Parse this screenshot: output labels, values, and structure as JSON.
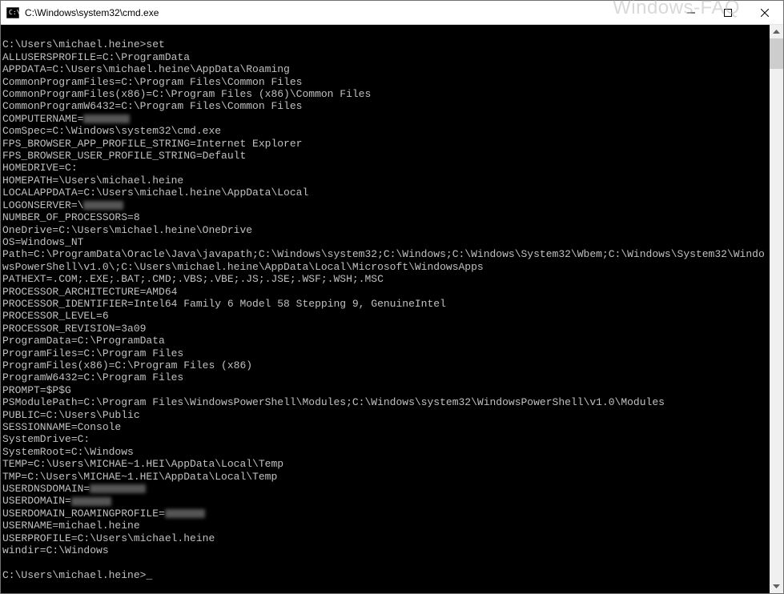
{
  "watermark": "Windows-FAQ",
  "window": {
    "title": "C:\\Windows\\system32\\cmd.exe"
  },
  "console": {
    "prompt1": "C:\\Users\\michael.heine>",
    "command1": "set",
    "prompt2": "C:\\Users\\michael.heine>",
    "envLines": [
      {
        "k": "ALLUSERSPROFILE",
        "v": "C:\\ProgramData"
      },
      {
        "k": "APPDATA",
        "v": "C:\\Users\\michael.heine\\AppData\\Roaming"
      },
      {
        "k": "CommonProgramFiles",
        "v": "C:\\Program Files\\Common Files"
      },
      {
        "k": "CommonProgramFiles(x86)",
        "v": "C:\\Program Files (x86)\\Common Files"
      },
      {
        "k": "CommonProgramW6432",
        "v": "C:\\Program Files\\Common Files"
      },
      {
        "k": "COMPUTERNAME",
        "v": "",
        "redacted": 58
      },
      {
        "k": "ComSpec",
        "v": "C:\\Windows\\system32\\cmd.exe"
      },
      {
        "k": "FPS_BROWSER_APP_PROFILE_STRING",
        "v": "Internet Explorer"
      },
      {
        "k": "FPS_BROWSER_USER_PROFILE_STRING",
        "v": "Default"
      },
      {
        "k": "HOMEDRIVE",
        "v": "C:"
      },
      {
        "k": "HOMEPATH",
        "v": "\\Users\\michael.heine"
      },
      {
        "k": "LOCALAPPDATA",
        "v": "C:\\Users\\michael.heine\\AppData\\Local"
      },
      {
        "k": "LOGONSERVER",
        "v": "\\",
        "redacted": 50
      },
      {
        "k": "NUMBER_OF_PROCESSORS",
        "v": "8"
      },
      {
        "k": "OneDrive",
        "v": "C:\\Users\\michael.heine\\OneDrive"
      },
      {
        "k": "OS",
        "v": "Windows_NT"
      },
      {
        "k": "Path",
        "v": "C:\\ProgramData\\Oracle\\Java\\javapath;C:\\Windows\\system32;C:\\Windows;C:\\Windows\\System32\\Wbem;C:\\Windows\\System32\\WindowsPowerShell\\v1.0\\;C:\\Users\\michael.heine\\AppData\\Local\\Microsoft\\WindowsApps"
      },
      {
        "k": "PATHEXT",
        "v": ".COM;.EXE;.BAT;.CMD;.VBS;.VBE;.JS;.JSE;.WSF;.WSH;.MSC"
      },
      {
        "k": "PROCESSOR_ARCHITECTURE",
        "v": "AMD64"
      },
      {
        "k": "PROCESSOR_IDENTIFIER",
        "v": "Intel64 Family 6 Model 58 Stepping 9, GenuineIntel"
      },
      {
        "k": "PROCESSOR_LEVEL",
        "v": "6"
      },
      {
        "k": "PROCESSOR_REVISION",
        "v": "3a09"
      },
      {
        "k": "ProgramData",
        "v": "C:\\ProgramData"
      },
      {
        "k": "ProgramFiles",
        "v": "C:\\Program Files"
      },
      {
        "k": "ProgramFiles(x86)",
        "v": "C:\\Program Files (x86)"
      },
      {
        "k": "ProgramW6432",
        "v": "C:\\Program Files"
      },
      {
        "k": "PROMPT",
        "v": "$P$G"
      },
      {
        "k": "PSModulePath",
        "v": "C:\\Program Files\\WindowsPowerShell\\Modules;C:\\Windows\\system32\\WindowsPowerShell\\v1.0\\Modules"
      },
      {
        "k": "PUBLIC",
        "v": "C:\\Users\\Public"
      },
      {
        "k": "SESSIONNAME",
        "v": "Console"
      },
      {
        "k": "SystemDrive",
        "v": "C:"
      },
      {
        "k": "SystemRoot",
        "v": "C:\\Windows"
      },
      {
        "k": "TEMP",
        "v": "C:\\Users\\MICHAE~1.HEI\\AppData\\Local\\Temp"
      },
      {
        "k": "TMP",
        "v": "C:\\Users\\MICHAE~1.HEI\\AppData\\Local\\Temp"
      },
      {
        "k": "USERDNSDOMAIN",
        "v": "",
        "redacted": 70
      },
      {
        "k": "USERDOMAIN",
        "v": "",
        "redacted": 50
      },
      {
        "k": "USERDOMAIN_ROAMINGPROFILE",
        "v": "",
        "redacted": 50
      },
      {
        "k": "USERNAME",
        "v": "michael.heine"
      },
      {
        "k": "USERPROFILE",
        "v": "C:\\Users\\michael.heine"
      },
      {
        "k": "windir",
        "v": "C:\\Windows"
      }
    ]
  }
}
